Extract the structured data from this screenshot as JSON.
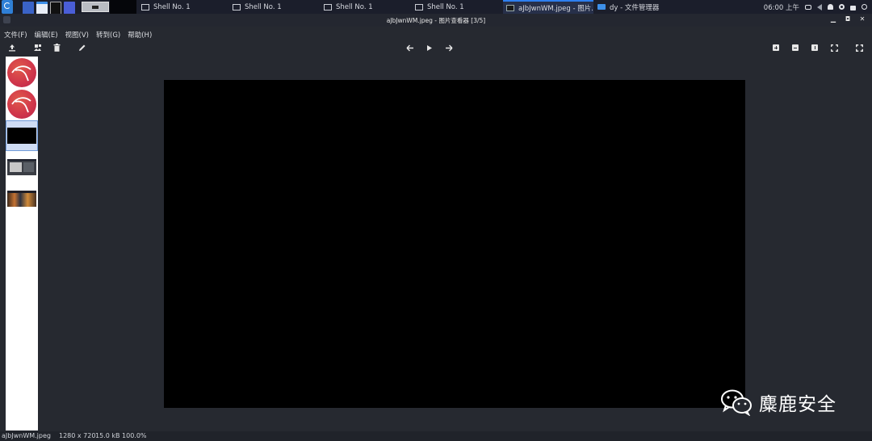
{
  "taskbar": {
    "tasks": [
      {
        "label": "Shell No. 1"
      },
      {
        "label": "Shell No. 1"
      },
      {
        "label": "Shell No. 1"
      },
      {
        "label": "Shell No. 1"
      },
      {
        "label": "aJbJwnWM.jpeg - 图片..."
      },
      {
        "label": "dy - 文件管理器"
      }
    ],
    "clock": "06:00 上午"
  },
  "window": {
    "title": "aJbJwnWM.jpeg - 图片查看器 [3/5]"
  },
  "menubar": {
    "items": [
      "文件(F)",
      "编辑(E)",
      "视图(V)",
      "转到(G)",
      "帮助(H)"
    ]
  },
  "toolbar": {
    "icons": [
      "upload-icon",
      "open-with-icon",
      "trash-icon",
      "edit-icon",
      "arrow-left-icon",
      "play-icon",
      "arrow-right-icon",
      "zoom-in-icon",
      "zoom-out-icon",
      "zoom-fit-icon",
      "fit-window-icon",
      "fullscreen-icon"
    ]
  },
  "thumbnails": {
    "count": 5,
    "selected_index": 2
  },
  "image": {
    "width": 1280,
    "height": 720,
    "content_color": "#000000"
  },
  "statusbar": {
    "filename": "aJbJwnWM.jpeg",
    "dimensions": "1280 x 720",
    "size_zoom": "15.0 kB 100.0%"
  },
  "watermark": {
    "text": "麋鹿安全"
  },
  "colors": {
    "taskbar_bg": "#1b1e2b",
    "window_bg": "#262930",
    "accent": "#2e7ff0",
    "thumb_selected": "#cfdcf4"
  }
}
